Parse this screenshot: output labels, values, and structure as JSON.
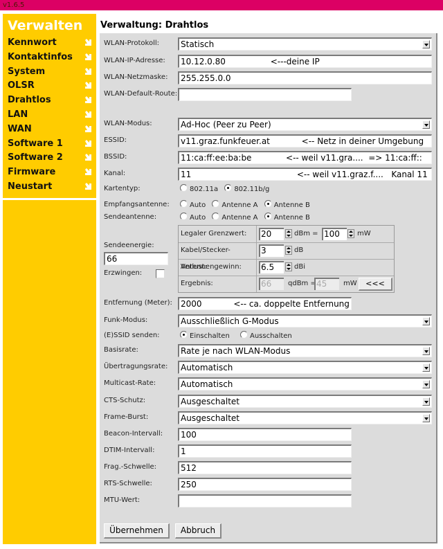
{
  "version": "v1.6.5",
  "colors": {
    "topbar": "#dc0064",
    "sidebar": "#ffcc00",
    "panel": "#dcdcdc"
  },
  "sidebar": {
    "title": "Verwalten",
    "items": [
      {
        "label": "Kennwort",
        "icon": "arrow-down-right-icon"
      },
      {
        "label": "Kontaktinfos",
        "icon": "arrow-down-right-icon"
      },
      {
        "label": "System",
        "icon": "arrow-down-right-icon"
      },
      {
        "label": "OLSR",
        "icon": "arrow-down-right-icon"
      },
      {
        "label": "Drahtlos",
        "icon": "arrow-down-right-icon"
      },
      {
        "label": "LAN",
        "icon": "arrow-down-right-icon"
      },
      {
        "label": "WAN",
        "icon": "arrow-down-right-icon"
      },
      {
        "label": "Software 1",
        "icon": "arrow-down-right-icon"
      },
      {
        "label": "Software 2",
        "icon": "arrow-down-right-icon"
      },
      {
        "label": "Firmware",
        "icon": "arrow-down-right-icon"
      },
      {
        "label": "Neustart",
        "icon": "arrow-down-right-icon"
      }
    ]
  },
  "page_title": "Verwaltung: Drahtlos",
  "form": {
    "wlan_protokoll": {
      "label": "WLAN-Protokoll:",
      "value": "Statisch"
    },
    "wlan_ip": {
      "label": "WLAN-IP-Adresse:",
      "value": "10.12.0.80                 <---deine IP"
    },
    "wlan_netmask": {
      "label": "WLAN-Netzmaske:",
      "value": "255.255.0.0"
    },
    "wlan_default_route": {
      "label": "WLAN-Default-Route:",
      "value": ""
    },
    "wlan_modus": {
      "label": "WLAN-Modus:",
      "value": "Ad-Hoc (Peer zu Peer)"
    },
    "essid": {
      "label": "ESSID:",
      "value": "v11.graz.funkfeuer.at            <-- Netz in deiner Umgebung"
    },
    "bssid": {
      "label": "BSSID:",
      "value": "11:ca:ff:ee:ba:be             <-- weil v11.gra....  => 11:ca:ff::"
    },
    "kanal": {
      "label": "Kanal:",
      "value": "11                                        <-- weil v11.graz.f....   Kanal 11"
    },
    "kartentyp": {
      "label": "Kartentyp:",
      "options": [
        "802.11a",
        "802.11b/g"
      ],
      "selected": "802.11b/g"
    },
    "empfangsantenne": {
      "label": "Empfangsantenne:",
      "options": [
        "Auto",
        "Antenne A",
        "Antenne B"
      ],
      "selected": "Antenne B"
    },
    "sendeantenne": {
      "label": "Sendeantenne:",
      "options": [
        "Auto",
        "Antenne A",
        "Antenne B"
      ],
      "selected": "Antenne B"
    },
    "sendeenergie": {
      "label": "Sendeenergie:",
      "value": "66",
      "erzwingen_label": "Erzwingen:",
      "erzwingen_checked": false
    },
    "power": {
      "legal_label": "Legaler Grenzwert:",
      "legal_dbm": "20",
      "dbm_eq": "dBm =",
      "legal_mw": "100",
      "mw": "mW",
      "kabel_label": "Kabel/Stecker-Verlust:",
      "kabel_db": "3",
      "db": "dB",
      "gain_label": "Antennengewinn:",
      "gain_dbi": "6.5",
      "dbi": "dBi",
      "result_label": "Ergebnis:",
      "result_qdbm": "66",
      "qdbm_eq": "qdBm =",
      "result_mw": "45",
      "result_mw_unit": "mW",
      "apply_button": "<<<"
    },
    "entfernung": {
      "label": "Entfernung (Meter):",
      "value": "2000            <-- ca. doppelte Entfernung"
    },
    "funk_modus": {
      "label": "Funk-Modus:",
      "value": "Ausschließlich G-Modus"
    },
    "essid_senden": {
      "label": "(E)SSID senden:",
      "options": [
        "Einschalten",
        "Ausschalten"
      ],
      "selected": "Einschalten"
    },
    "basisrate": {
      "label": "Basisrate:",
      "value": "Rate je nach WLAN-Modus"
    },
    "uebertragungsrate": {
      "label": "Übertragungsrate:",
      "value": "Automatisch"
    },
    "multicast_rate": {
      "label": "Multicast-Rate:",
      "value": "Automatisch"
    },
    "cts_schutz": {
      "label": "CTS-Schutz:",
      "value": "Ausgeschaltet"
    },
    "frame_burst": {
      "label": "Frame-Burst:",
      "value": "Ausgeschaltet"
    },
    "beacon_intervall": {
      "label": "Beacon-Intervall:",
      "value": "100"
    },
    "dtim_intervall": {
      "label": "DTIM-Intervall:",
      "value": "1"
    },
    "frag_schwelle": {
      "label": "Frag.-Schwelle:",
      "value": "512"
    },
    "rts_schwelle": {
      "label": "RTS-Schwelle:",
      "value": "250"
    },
    "mtu_wert": {
      "label": "MTU-Wert:",
      "value": ""
    }
  },
  "buttons": {
    "apply": "Übernehmen",
    "cancel": "Abbruch"
  }
}
